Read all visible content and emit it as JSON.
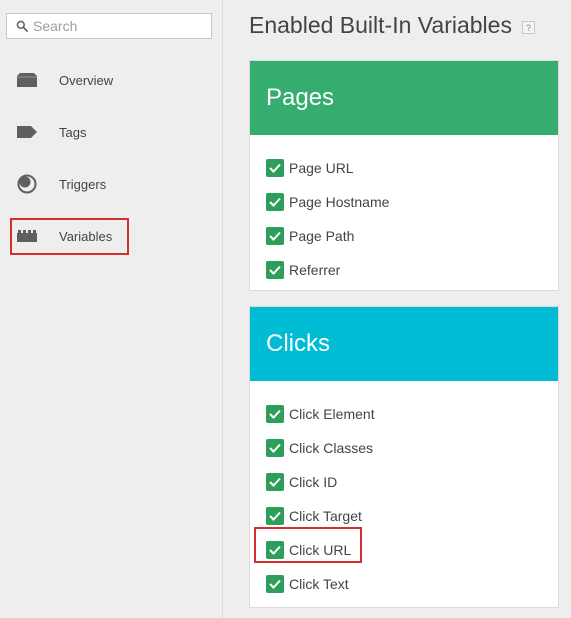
{
  "sidebar": {
    "search": {
      "placeholder": "Search",
      "value": ""
    },
    "items": [
      {
        "label": "Overview",
        "icon": "briefcase-icon"
      },
      {
        "label": "Tags",
        "icon": "tag-icon"
      },
      {
        "label": "Triggers",
        "icon": "trigger-icon"
      },
      {
        "label": "Variables",
        "icon": "lego-block-icon",
        "highlighted": true
      }
    ]
  },
  "main": {
    "title": "Enabled Built-In Variables",
    "help": "?",
    "sections": [
      {
        "title": "Pages",
        "color": "#34ad6e",
        "items": [
          {
            "label": "Page URL",
            "checked": true
          },
          {
            "label": "Page Hostname",
            "checked": true
          },
          {
            "label": "Page Path",
            "checked": true
          },
          {
            "label": "Referrer",
            "checked": true
          }
        ]
      },
      {
        "title": "Clicks",
        "color": "#00bcd4",
        "items": [
          {
            "label": "Click Element",
            "checked": true
          },
          {
            "label": "Click Classes",
            "checked": true
          },
          {
            "label": "Click ID",
            "checked": true
          },
          {
            "label": "Click Target",
            "checked": true
          },
          {
            "label": "Click URL",
            "checked": true,
            "highlighted": true
          },
          {
            "label": "Click Text",
            "checked": true
          }
        ]
      }
    ]
  },
  "colors": {
    "highlight": "#d32f2f",
    "checkbox": "#2e9e5b"
  }
}
